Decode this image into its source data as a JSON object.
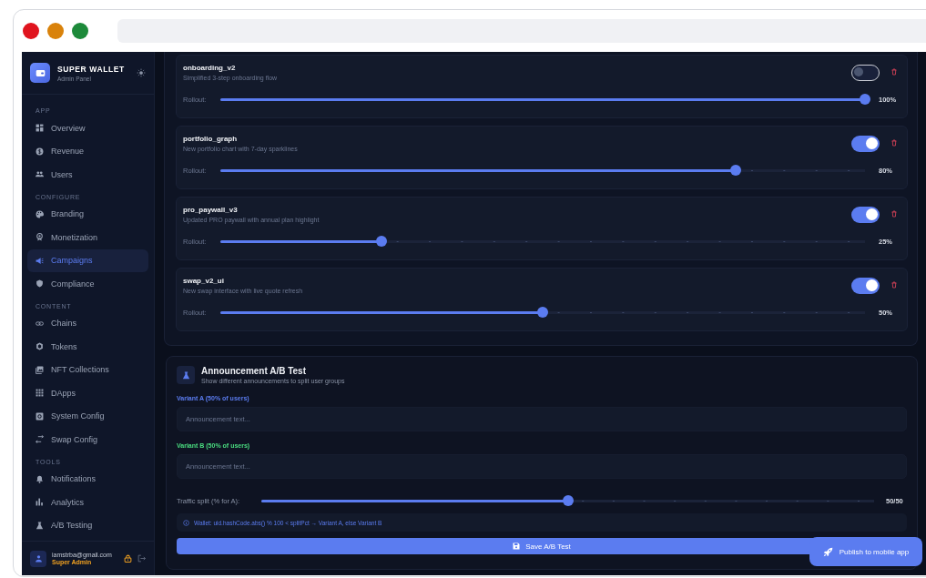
{
  "sidebar": {
    "brand": {
      "title": "SUPER WALLET",
      "subtitle": "Admin Panel"
    },
    "sections": [
      {
        "label": "APP",
        "items": [
          {
            "label": "Overview",
            "selected": false
          },
          {
            "label": "Revenue",
            "selected": false
          },
          {
            "label": "Users",
            "selected": false
          }
        ]
      },
      {
        "label": "CONFIGURE",
        "items": [
          {
            "label": "Branding",
            "selected": false
          },
          {
            "label": "Monetization",
            "selected": false
          },
          {
            "label": "Campaigns",
            "selected": true
          },
          {
            "label": "Compliance",
            "selected": false
          }
        ]
      },
      {
        "label": "CONTENT",
        "items": [
          {
            "label": "Chains",
            "selected": false
          },
          {
            "label": "Tokens",
            "selected": false
          },
          {
            "label": "NFT Collections",
            "selected": false
          },
          {
            "label": "DApps",
            "selected": false
          },
          {
            "label": "System Config",
            "selected": false
          },
          {
            "label": "Swap Config",
            "selected": false
          }
        ]
      },
      {
        "label": "TOOLS",
        "items": [
          {
            "label": "Notifications",
            "selected": false
          },
          {
            "label": "Analytics",
            "selected": false
          },
          {
            "label": "A/B Testing",
            "selected": false
          }
        ]
      }
    ],
    "user": {
      "email": "iamstrba@gmail.com",
      "role": "Super Admin"
    }
  },
  "flags": [
    {
      "name": "onboarding_v2",
      "description": "Simplified 3-step onboarding flow",
      "on": false,
      "rollout_label": "Rollout:",
      "level": 1.0,
      "reading": "100%"
    },
    {
      "name": "portfolio_graph",
      "description": "New portfolio chart with 7-day sparklines",
      "on": true,
      "rollout_label": "Rollout:",
      "level": 0.8,
      "reading": "80%"
    },
    {
      "name": "pro_paywall_v3",
      "description": "Updated PRO paywall with annual plan highlight",
      "on": true,
      "rollout_label": "Rollout:",
      "level": 0.25,
      "reading": "25%"
    },
    {
      "name": "swap_v2_ui",
      "description": "New swap interface with live quote refresh",
      "on": true,
      "rollout_label": "Rollout:",
      "level": 0.5,
      "reading": "50%"
    }
  ],
  "ab_test": {
    "title": "Announcement A/B Test",
    "subtitle": "Show different announcements to split user groups",
    "variants": [
      {
        "label": "Variant A (50% of users)",
        "color": "#5b7cf0",
        "placeholder": "Announcement text..."
      },
      {
        "label": "Variant B (50% of users)",
        "color": "#4ade80",
        "placeholder": "Announcement text..."
      }
    ],
    "split": {
      "label": "Traffic split (% for A):",
      "level": 0.5,
      "reading": "50/50"
    },
    "info": "Wallet: uid.hashCode.abs() % 100 < splitPct → Variant A, else Variant B",
    "save_button": "Save A/B Test"
  },
  "publish_button": "Publish to mobile app"
}
